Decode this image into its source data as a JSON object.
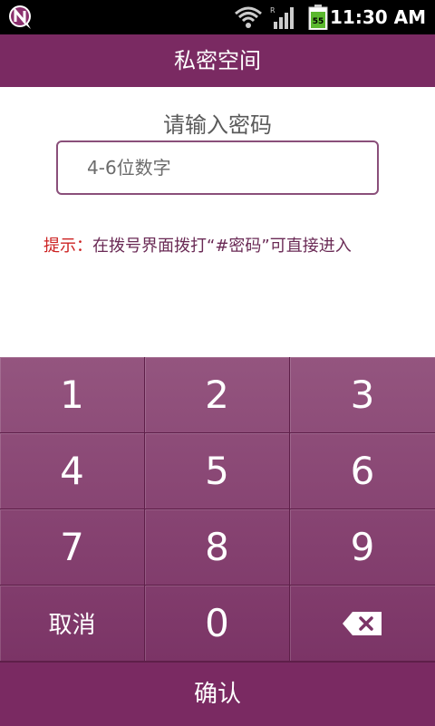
{
  "status_bar": {
    "time": "11:30 AM",
    "battery_level": "55",
    "icons": [
      "app-notification-icon",
      "wifi-icon",
      "signal-icon",
      "battery-icon"
    ],
    "roaming_indicator": "R"
  },
  "title_bar": {
    "title": "私密空间"
  },
  "form": {
    "prompt": "请输入密码",
    "password_placeholder": "4-6位数字",
    "password_value": ""
  },
  "hint": {
    "label": "提示：",
    "text": "在拨号界面拨打“#密码”可直接进入"
  },
  "keypad": {
    "keys": [
      "1",
      "2",
      "3",
      "4",
      "5",
      "6",
      "7",
      "8",
      "9",
      "取消",
      "0",
      "backspace-icon"
    ]
  },
  "confirm": {
    "label": "确认"
  },
  "colors": {
    "brand": "#7a2a62",
    "keypad_top": "#94557f",
    "keypad_bottom": "#7b3466",
    "input_border": "#8a4f7a",
    "hint_label": "#cc2222",
    "hint_text": "#6a2a55"
  }
}
